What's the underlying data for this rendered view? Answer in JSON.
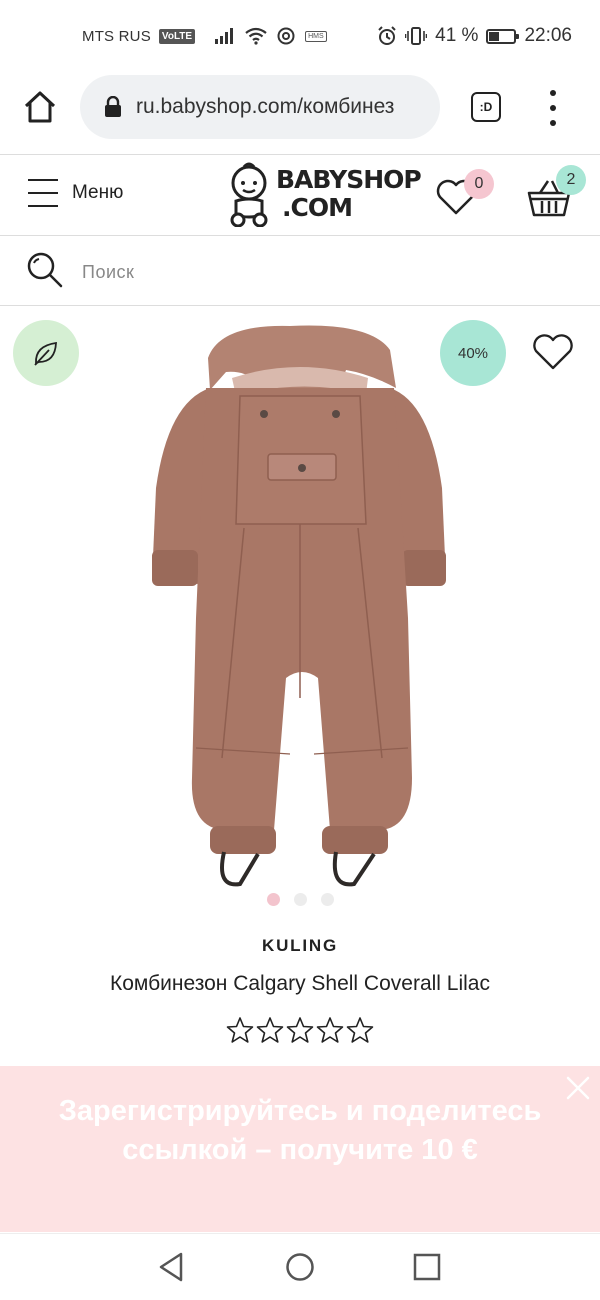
{
  "status_bar": {
    "carrier": "MTS RUS",
    "volte": "VoLTE",
    "hms": "HMS",
    "battery_text": "41 %",
    "battery_level": 0.41,
    "time": "22:06"
  },
  "browser": {
    "url": "ru.babyshop.com/комбинез",
    "tab_label": ":D"
  },
  "header": {
    "menu_label": "Меню",
    "logo_line1": "BABYSHOP",
    "logo_line2": ".COM",
    "wishlist_count": "0",
    "cart_count": "2"
  },
  "search": {
    "placeholder": "Поиск"
  },
  "product": {
    "discount": "40%",
    "brand": "KULING",
    "title": "Комбинезон Calgary Shell Coverall Lilac",
    "rating": 0,
    "rating_max": 5,
    "image_index": 0,
    "image_count": 3
  },
  "promo": {
    "text": "Зарегистрируйтесь и поделитесь ссылкой – получите 10 €"
  },
  "colors": {
    "eco_badge_bg": "#d5efd3",
    "discount_badge_bg": "#a8e6d5",
    "wishlist_badge_bg": "#f5c6d0",
    "cart_badge_bg": "#a8e6d5",
    "promo_bg": "#fde2e3",
    "garment": "#a97766"
  },
  "icons": {
    "home": "home-icon",
    "lock": "lock-icon",
    "tabs": "tabs-icon",
    "more": "more-vertical-icon",
    "menu": "hamburger-icon",
    "wishlist": "heart-icon",
    "cart": "basket-icon",
    "search": "search-icon",
    "eco": "leaf-icon",
    "close": "close-icon"
  }
}
